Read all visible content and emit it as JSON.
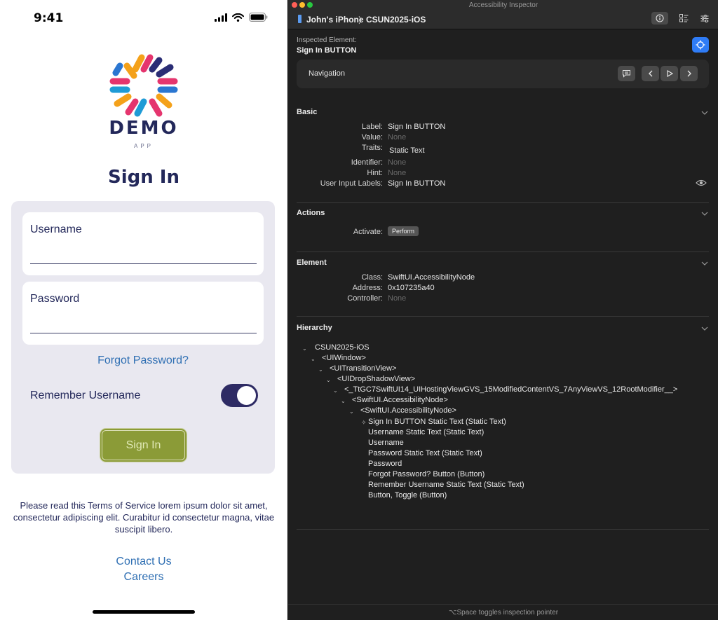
{
  "phone": {
    "status": {
      "time": "9:41"
    },
    "logo": {
      "word": "DEMO",
      "sub": "APP"
    },
    "title": "Sign In",
    "username": {
      "label": "Username",
      "value": ""
    },
    "password": {
      "label": "Password",
      "value": ""
    },
    "forgot": "Forgot Password?",
    "remember": {
      "label": "Remember Username",
      "on": true
    },
    "signin_button": "Sign In",
    "terms": "Please read this Terms of Service lorem ipsum dolor sit amet, consectetur adipiscing elit. Curabitur id consectetur magna, vitae suscipit libero.",
    "contact": "Contact Us",
    "careers": "Careers"
  },
  "inspector": {
    "window_title": "Accessibility Inspector",
    "device": "John's iPhone",
    "target": "CSUN2025-iOS",
    "inspected_label": "Inspected Element:",
    "inspected_name": "Sign In BUTTON",
    "navigation_label": "Navigation",
    "basic": {
      "title": "Basic",
      "label_key": "Label:",
      "label_val": "Sign In BUTTON",
      "value_key": "Value:",
      "value_val": "None",
      "traits_key": "Traits:",
      "traits_val": "Static Text",
      "identifier_key": "Identifier:",
      "identifier_val": "None",
      "hint_key": "Hint:",
      "hint_val": "None",
      "uil_key": "User Input Labels:",
      "uil_val": "Sign In BUTTON"
    },
    "actions": {
      "title": "Actions",
      "activate_key": "Activate:",
      "perform": "Perform"
    },
    "element": {
      "title": "Element",
      "class_key": "Class:",
      "class_val": "SwiftUI.AccessibilityNode",
      "address_key": "Address:",
      "address_val": "0x107235a40",
      "controller_key": "Controller:",
      "controller_val": "None"
    },
    "hierarchy": {
      "title": "Hierarchy",
      "nodes": [
        "CSUN2025-iOS",
        "<UIWindow>",
        "<UITransitionView>",
        "<UIDropShadowView>",
        "<_TtGC7SwiftUI14_UIHostingViewGVS_15ModifiedContentVS_7AnyViewVS_12RootModifier__>",
        "<SwiftUI.AccessibilityNode>",
        "<SwiftUI.AccessibilityNode>",
        "Sign In BUTTON Static Text (Static Text)",
        "Username Static Text (Static Text)",
        "Username",
        "Password Static Text (Static Text)",
        "Password",
        "Forgot Password? Button (Button)",
        "Remember Username Static Text (Static Text)",
        "Button, Toggle (Button)"
      ]
    },
    "bottom_hint": "⌥Space toggles inspection pointer"
  }
}
